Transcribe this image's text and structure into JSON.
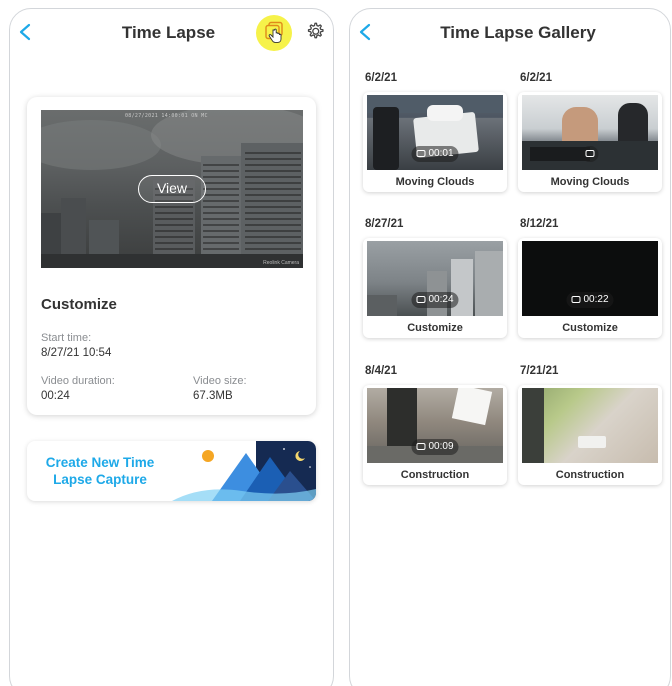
{
  "left": {
    "title": "Time Lapse",
    "preview_button": "View",
    "preview_stamp": "08/27/2021 14:00:01 ON MC",
    "preview_watermark": "Reolink Camera",
    "card_title": "Customize",
    "start_time_label": "Start time:",
    "start_time_value": "8/27/21 10:54",
    "duration_label": "Video duration:",
    "duration_value": "00:24",
    "size_label": "Video size:",
    "size_value": "67.3MB",
    "create_line1": "Create New Time",
    "create_line2": "Lapse Capture"
  },
  "right": {
    "title": "Time Lapse Gallery",
    "items": [
      {
        "date": "6/2/21",
        "name": "Moving Clouds",
        "duration": "00:01"
      },
      {
        "date": "6/2/21",
        "name": "Moving Clouds",
        "duration": ""
      },
      {
        "date": "8/27/21",
        "name": "Customize",
        "duration": "00:24"
      },
      {
        "date": "8/12/21",
        "name": "Customize",
        "duration": "00:22"
      },
      {
        "date": "8/4/21",
        "name": "Construction",
        "duration": "00:09"
      },
      {
        "date": "7/21/21",
        "name": "Construction",
        "duration": ""
      }
    ]
  },
  "colors": {
    "accent": "#1ea9e8",
    "highlight": "#f6f24a",
    "text": "#333333",
    "muted": "#8a8d91"
  },
  "icons": [
    "back-arrow-icon",
    "gallery-icon",
    "hand-cursor-icon",
    "settings-gear-icon",
    "camera-icon",
    "sun-icon",
    "moon-icon"
  ]
}
